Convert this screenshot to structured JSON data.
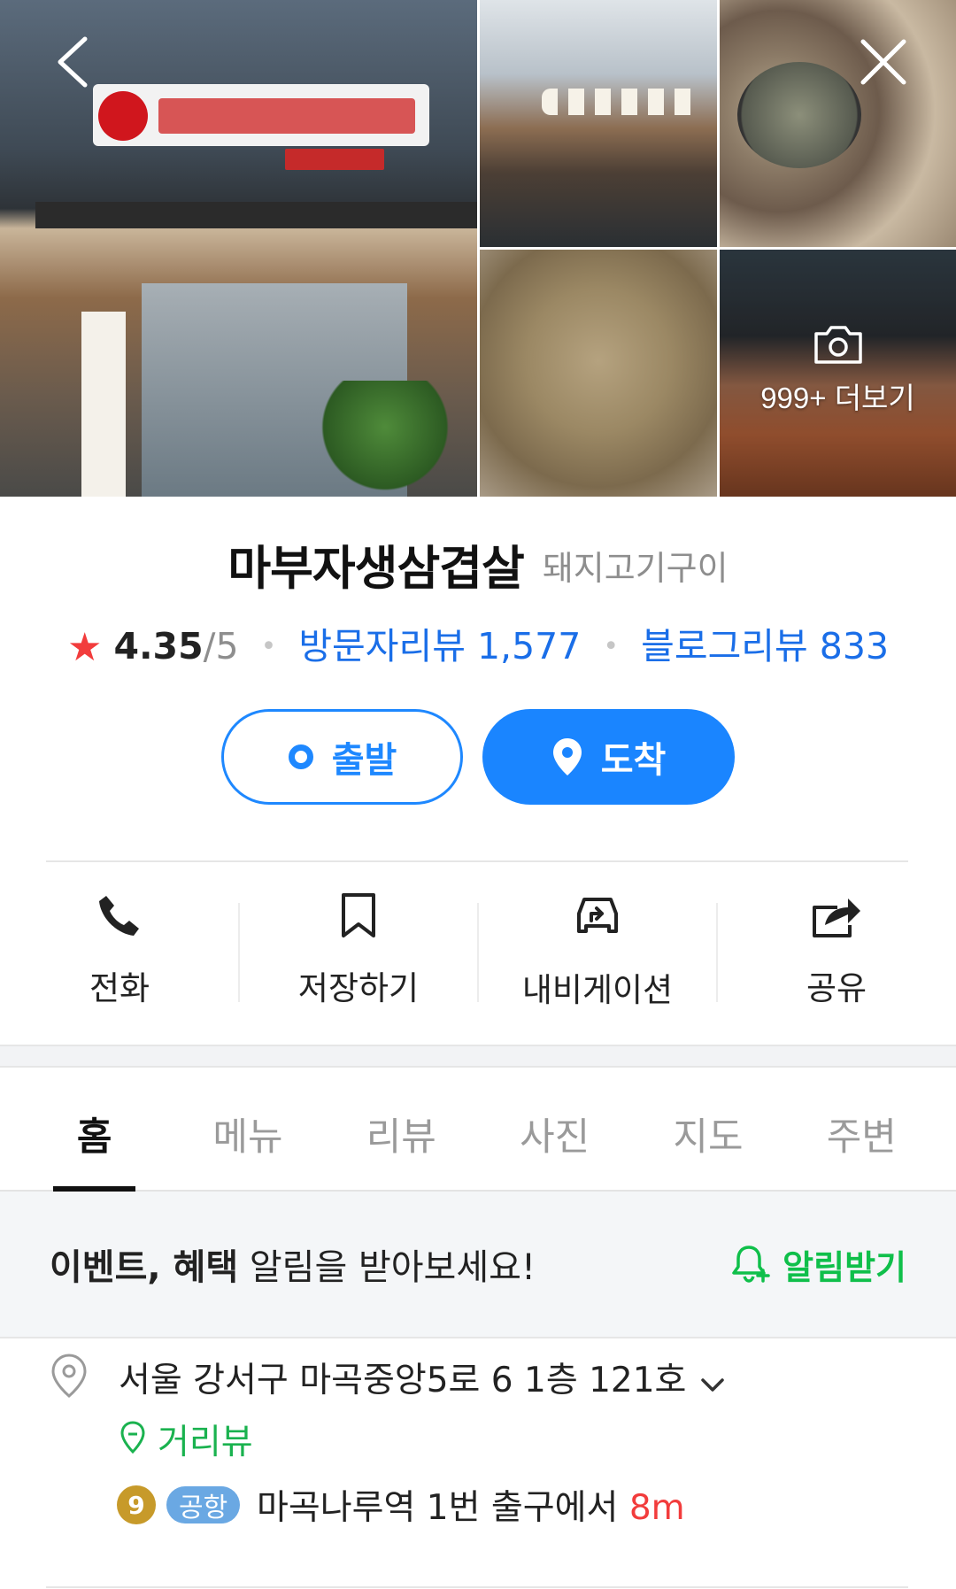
{
  "gallery": {
    "more_label": "999+ 더보기"
  },
  "place": {
    "name": "마부자생삼겹살",
    "category": "돼지고기구이",
    "rating": "4.35",
    "rating_max": "/5",
    "visitor_review_label": "방문자리뷰 1,577",
    "blog_review_label": "블로그리뷰 833"
  },
  "buttons": {
    "depart": "출발",
    "arrive": "도착"
  },
  "actions": [
    {
      "label": "전화",
      "icon": "phone-icon"
    },
    {
      "label": "저장하기",
      "icon": "bookmark-icon"
    },
    {
      "label": "내비게이션",
      "icon": "navigation-car-icon"
    },
    {
      "label": "공유",
      "icon": "share-icon"
    }
  ],
  "tabs": [
    {
      "label": "홈",
      "active": true
    },
    {
      "label": "메뉴",
      "active": false
    },
    {
      "label": "리뷰",
      "active": false
    },
    {
      "label": "사진",
      "active": false
    },
    {
      "label": "지도",
      "active": false
    },
    {
      "label": "주변",
      "active": false
    }
  ],
  "notice": {
    "bold": "이벤트, 혜택",
    "text": " 알림을 받아보세요!",
    "button": "알림받기"
  },
  "info": {
    "address": "서울 강서구 마곡중앙5로 6 1층 121호",
    "street_view": "거리뷰",
    "subway_line": "9",
    "subway_badge": "공항",
    "subway_text": "마곡나루역 1번 출구에서 ",
    "subway_distance": "8m"
  },
  "colors": {
    "accent_blue": "#1a85ff",
    "link_blue": "#1a6ee8",
    "star_red": "#f23c3c",
    "green": "#0fbf4a",
    "line9_gold": "#c79a2a",
    "airport_blue": "#6aa8e3"
  }
}
